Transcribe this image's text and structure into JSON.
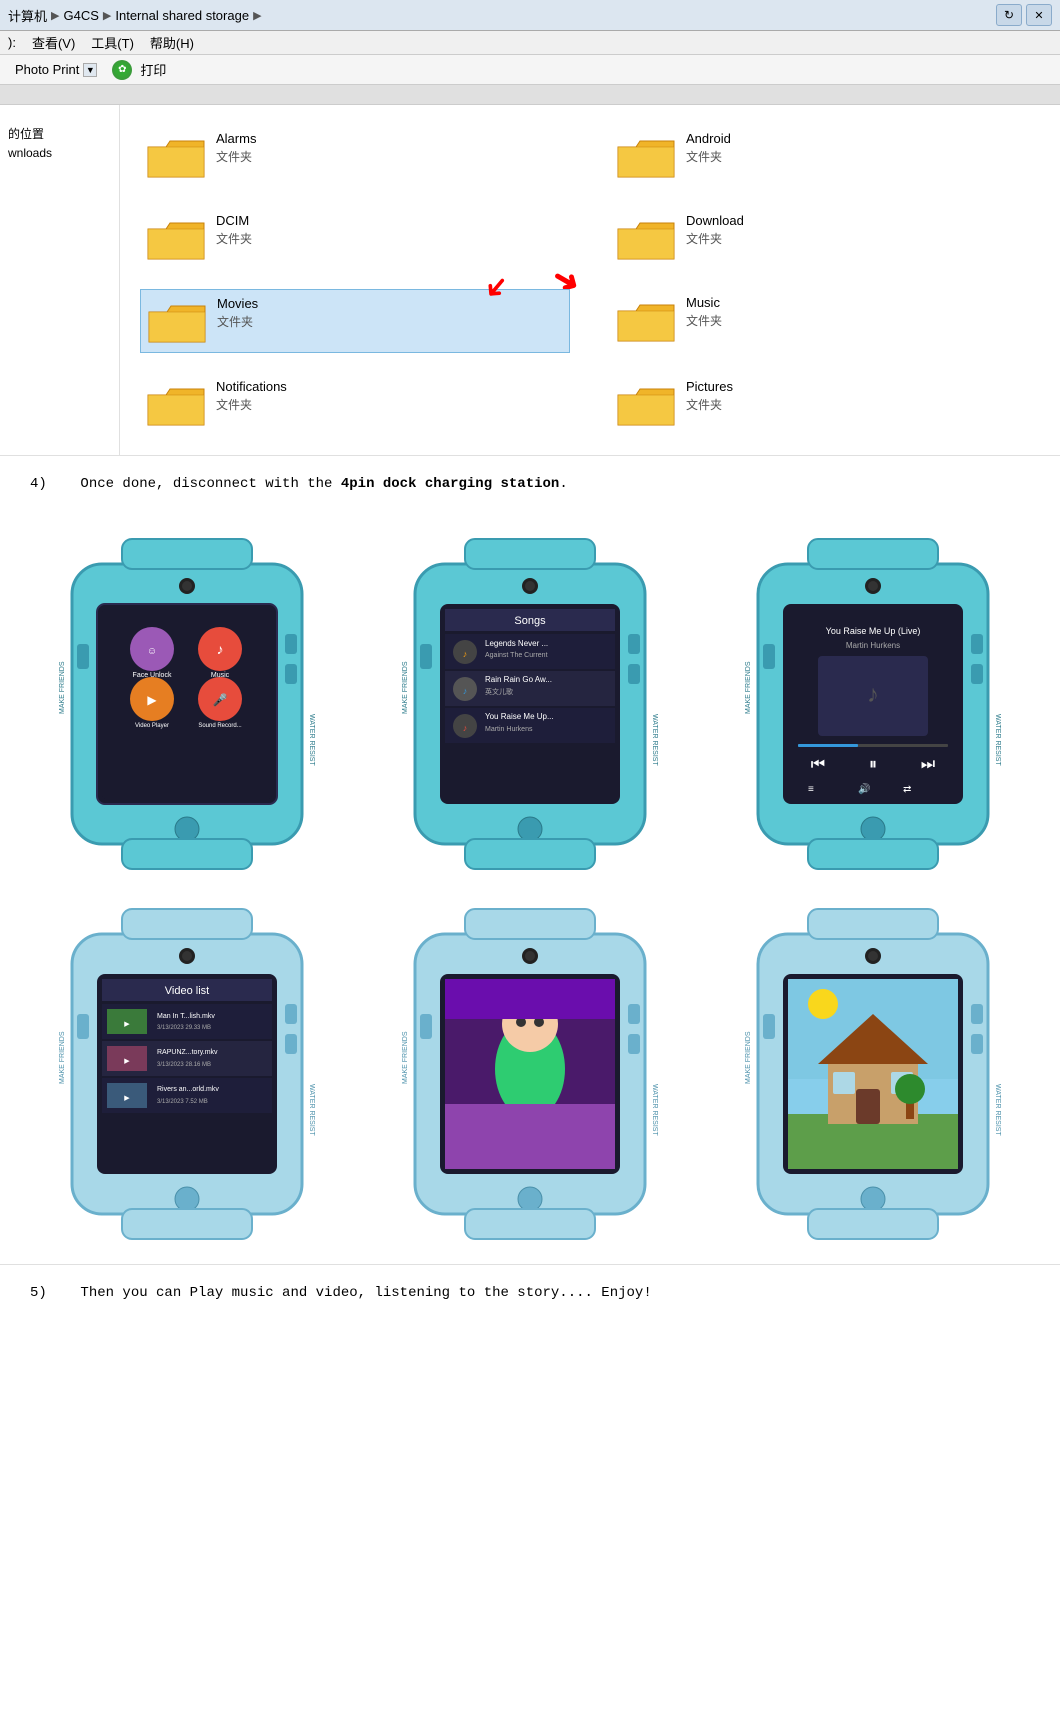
{
  "explorer": {
    "path": {
      "pc": "计算机",
      "arrow1": "▶",
      "g4cs": "G4CS",
      "arrow2": "▶",
      "storage": "Internal shared storage",
      "arrow3": "▶"
    },
    "menu": [
      {
        "id": "view",
        "label": "查看(V)"
      },
      {
        "id": "tools",
        "label": "工具(T)"
      },
      {
        "id": "help",
        "label": "帮助(H)"
      }
    ],
    "toolbar": {
      "photo_print": "Photo Print",
      "print_label": "打印"
    }
  },
  "folders": [
    {
      "id": "alarms",
      "name": "Alarms",
      "type": "文件夹",
      "selected": false,
      "arrow": null
    },
    {
      "id": "android",
      "name": "Android",
      "type": "文件夹",
      "selected": false,
      "arrow": null
    },
    {
      "id": "dcim",
      "name": "DCIM",
      "type": "文件夹",
      "selected": false,
      "arrow": "down-right"
    },
    {
      "id": "download",
      "name": "Download",
      "type": "文件夹",
      "selected": false,
      "arrow": null
    },
    {
      "id": "movies",
      "name": "Movies",
      "type": "文件夹",
      "selected": true,
      "arrow": "down-right"
    },
    {
      "id": "music",
      "name": "Music",
      "type": "文件夹",
      "selected": false,
      "arrow": "left"
    },
    {
      "id": "notifications",
      "name": "Notifications",
      "type": "文件夹",
      "selected": false,
      "arrow": null
    },
    {
      "id": "pictures",
      "name": "Pictures",
      "type": "文件夹",
      "selected": false,
      "arrow": null
    }
  ],
  "sidebar": {
    "my_location": "的位置",
    "downloads": "wnloads"
  },
  "section4": {
    "number": "4)",
    "text": "Once done, disconnect with the ",
    "bold_text": "4pin dock charging station",
    "end": "."
  },
  "watches_row1": [
    {
      "id": "w1",
      "screen": "menu",
      "items": [
        "Face Unlock",
        "Music",
        "Video Player",
        "Sound Record..."
      ]
    },
    {
      "id": "w2",
      "screen": "songs",
      "songs": [
        {
          "title": "Legends Never ...",
          "artist": "Against The Current"
        },
        {
          "title": "Rain Rain Go Aw...",
          "artist": "英文儿歌"
        },
        {
          "title": "You Raise Me Up...",
          "artist": "Martin Hurkens"
        }
      ],
      "header": "Songs"
    },
    {
      "id": "w3",
      "screen": "player",
      "song_title": "You Raise Me Up (Live)",
      "artist": "Martin Hurkens"
    }
  ],
  "watches_row2": [
    {
      "id": "w4",
      "screen": "video_list",
      "header": "Video list",
      "videos": [
        {
          "name": "Man In T...lish.mkv",
          "date": "3/13/2023 29.33 MB"
        },
        {
          "name": "RAPUNZ...tory.mkv",
          "date": "3/13/2023 28.16 MB"
        },
        {
          "name": "Rivers an...orld.mkv",
          "date": "3/13/2023 7.52 MB"
        }
      ]
    },
    {
      "id": "w5",
      "screen": "animation"
    },
    {
      "id": "w6",
      "screen": "cartoon"
    }
  ],
  "section5": {
    "number": "5)",
    "text": "Then you can Play music and video, listening to the story.... Enjoy!"
  }
}
